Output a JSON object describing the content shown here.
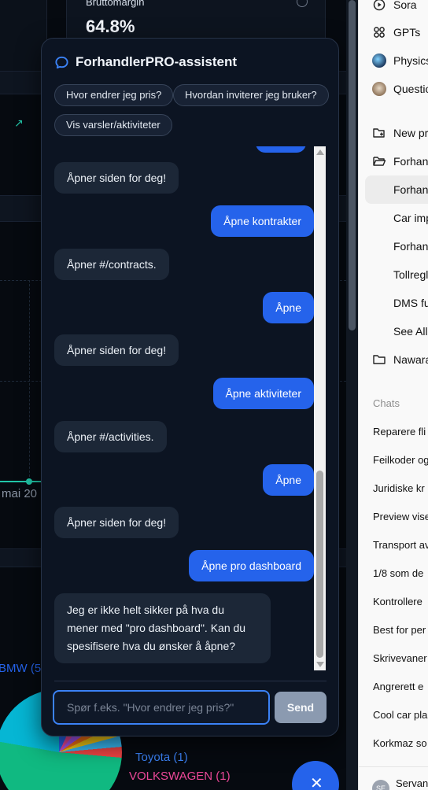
{
  "dashboard": {
    "kpi_label": "Bruttomargin",
    "kpi_value": "64.8%",
    "x_axis_label": "mai 20",
    "brand_label": "BMW (5",
    "legend": [
      {
        "label": "Toyota (1)",
        "color": "#3b82f6"
      },
      {
        "label": "VOLKSWAGEN (1)",
        "color": "#ec4899"
      }
    ]
  },
  "chat": {
    "title": "ForhandlerPRO-assistent",
    "suggestions": [
      "Hvor endrer jeg pris?",
      "Hvordan inviterer jeg bruker?",
      "Vis varsler/aktiviteter"
    ],
    "messages": [
      {
        "role": "bot",
        "text": "Åpner siden for deg!"
      },
      {
        "role": "user",
        "text": "Åpne kontrakter"
      },
      {
        "role": "bot",
        "text": "Åpner #/contracts."
      },
      {
        "role": "user",
        "text": "Åpne"
      },
      {
        "role": "bot",
        "text": "Åpner siden for deg!"
      },
      {
        "role": "user",
        "text": "Åpne aktiviteter"
      },
      {
        "role": "bot",
        "text": "Åpner #/activities."
      },
      {
        "role": "user",
        "text": "Åpne"
      },
      {
        "role": "bot",
        "text": "Åpner siden for deg!"
      },
      {
        "role": "user",
        "text": "Åpne pro dashboard"
      },
      {
        "role": "bot",
        "text": "Jeg er ikke helt sikker på hva du mener med \"pro dashboard\". Kan du spesifisere hva du ønsker å åpne?"
      }
    ],
    "input_placeholder": "Spør f.eks. \"Hvor endrer jeg pris?\"",
    "input_value": "",
    "send_label": "Send",
    "accent_color": "#2563eb"
  },
  "sidebar": {
    "items": [
      {
        "label": "Sora",
        "icon": "play-circle-icon"
      },
      {
        "label": "GPTs",
        "icon": "grid-icon"
      },
      {
        "label": "Physics",
        "icon": "physics-avatar-icon"
      },
      {
        "label": "Question",
        "icon": "owl-avatar-icon"
      },
      {
        "label": "New pr",
        "icon": "new-folder-icon"
      },
      {
        "label": "Forhand",
        "icon": "folder-open-icon"
      },
      {
        "label": "Forhand",
        "icon": ""
      },
      {
        "label": "Car imp",
        "icon": ""
      },
      {
        "label": "Forhand",
        "icon": ""
      },
      {
        "label": "Tollregl",
        "icon": ""
      },
      {
        "label": "DMS fu",
        "icon": ""
      },
      {
        "label": "See All",
        "icon": ""
      },
      {
        "label": "Nawara",
        "icon": "folder-icon"
      }
    ],
    "chats_heading": "Chats",
    "chats": [
      "Reparere fli",
      "Feilkoder og",
      "Juridiske kr",
      "Preview vise",
      "Transport av",
      "1/8 som de",
      "Kontrollere",
      "Best for per",
      "Skrivevaner",
      "Angrerett e",
      "Cool car pla",
      "Korkmaz so"
    ],
    "user_initials": "SE",
    "user_name": "Servan"
  }
}
